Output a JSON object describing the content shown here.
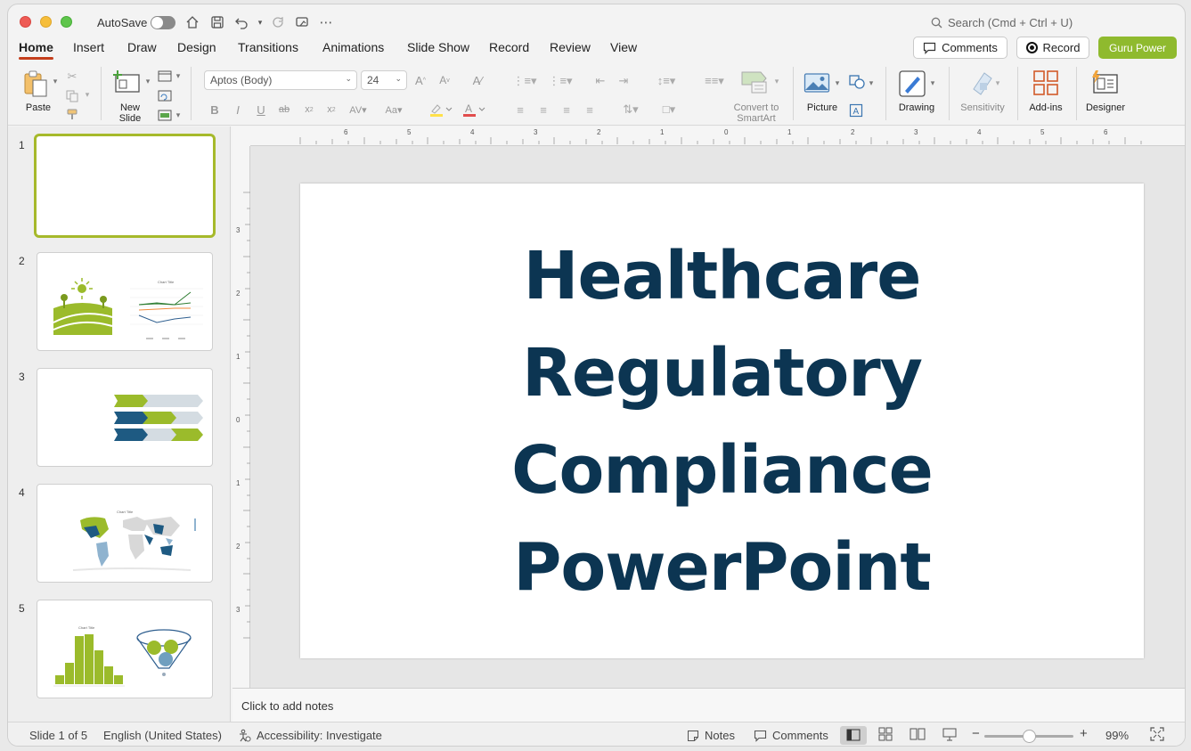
{
  "titlebar": {
    "autosave_label": "AutoSave",
    "search_placeholder": "Search (Cmd + Ctrl + U)"
  },
  "tabs": [
    "Home",
    "Insert",
    "Draw",
    "Design",
    "Transitions",
    "Animations",
    "Slide Show",
    "Record",
    "Review",
    "View"
  ],
  "actions": {
    "comments_label": "Comments",
    "record_label": "Record",
    "guru_label": "Guru Power"
  },
  "ribbon": {
    "paste_label": "Paste",
    "new_slide_label": "New\nSlide",
    "font_name": "Aptos (Body)",
    "font_size": "24",
    "convert_label": "Convert to\nSmartArt",
    "picture_label": "Picture",
    "drawing_label": "Drawing",
    "sensitivity_label": "Sensitivity",
    "addins_label": "Add-ins",
    "designer_label": "Designer"
  },
  "thumbnails": {
    "numbers": [
      "1",
      "2",
      "3",
      "4",
      "5"
    ],
    "chart_title": "Chart Title"
  },
  "ruler": {
    "h_ticks": [
      "6",
      "5",
      "4",
      "3",
      "2",
      "1",
      "0",
      "1",
      "2",
      "3",
      "4",
      "5",
      "6"
    ],
    "v_ticks": [
      "3",
      "2",
      "1",
      "0",
      "1",
      "2",
      "3"
    ]
  },
  "slide": {
    "title_lines": [
      "Healthcare",
      "Regulatory",
      "Compliance",
      "PowerPoint"
    ]
  },
  "notes": {
    "placeholder": "Click to add notes"
  },
  "status": {
    "slide_info": "Slide 1 of 5",
    "language": "English (United States)",
    "accessibility": "Accessibility: Investigate",
    "notes_label": "Notes",
    "comments_label": "Comments",
    "zoom": "99%"
  },
  "colors": {
    "accent_green": "#8fba2e",
    "title_navy": "#0c3552",
    "tab_underline": "#c43e1c"
  }
}
